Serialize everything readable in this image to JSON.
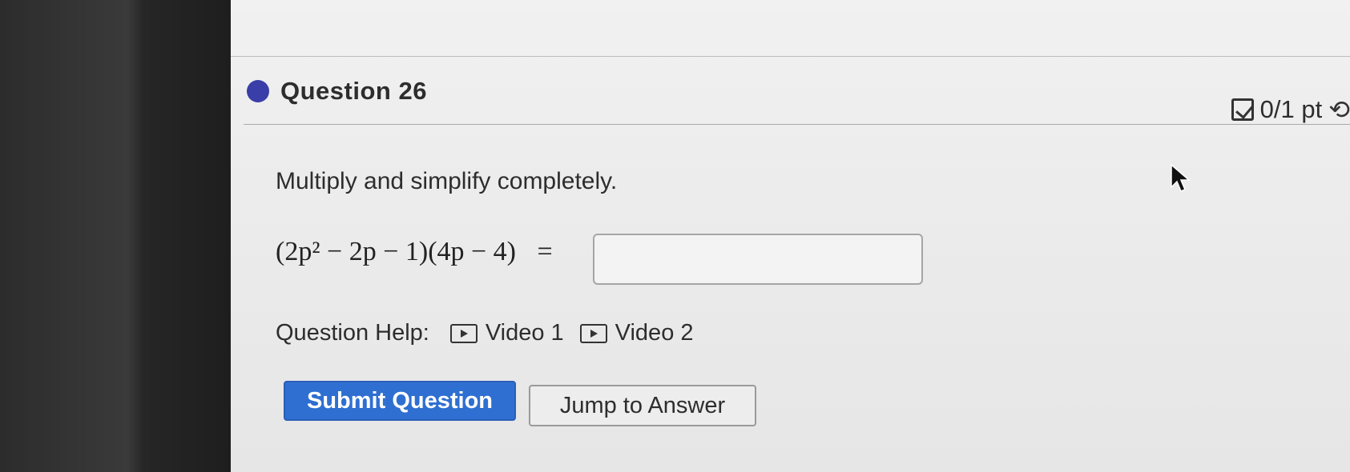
{
  "question": {
    "title": "Question 26",
    "score": "0/1 pt",
    "prompt": "Multiply and simplify completely.",
    "expression": "(2p² − 2p − 1)(4p − 4)",
    "equals": "=",
    "answer_value": ""
  },
  "help": {
    "label": "Question Help:",
    "videos": [
      "Video 1",
      "Video 2"
    ]
  },
  "buttons": {
    "submit": "Submit Question",
    "jump": "Jump to Answer"
  },
  "colors": {
    "status_dot": "#3a3ea8",
    "submit_bg": "#2f6fd1"
  },
  "icons": [
    "status-dot-icon",
    "checkbox-score-icon",
    "retry-icon",
    "video-icon",
    "mouse-pointer-icon"
  ]
}
